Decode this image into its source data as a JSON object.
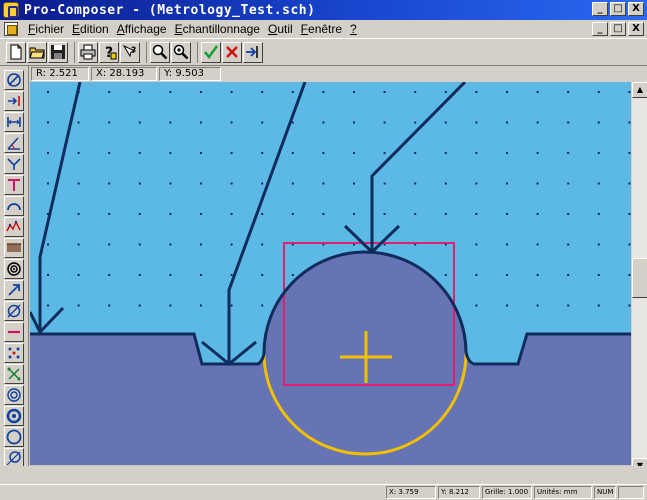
{
  "window": {
    "title": "Pro-Composer - (Metrology_Test.sch)",
    "controls": [
      "_",
      "□",
      "X"
    ]
  },
  "menu": {
    "items": [
      {
        "u": "F",
        "rest": "ichier"
      },
      {
        "u": "E",
        "rest": "dition"
      },
      {
        "u": "A",
        "rest": "ffichage"
      },
      {
        "u": "E",
        "rest": "chantillonnage"
      },
      {
        "u": "O",
        "rest": "util"
      },
      {
        "u": "F",
        "rest": "enêtre"
      },
      {
        "u": "?",
        "rest": ""
      }
    ],
    "doc_controls": [
      "_",
      "□",
      "X"
    ]
  },
  "toolbar": {
    "groups": [
      [
        "new-document-icon",
        "open-folder-icon",
        "save-disk-icon"
      ],
      [
        "print-icon",
        "help-question-icon",
        "context-help-icon"
      ],
      [
        "zoom-out-icon",
        "zoom-in-icon"
      ],
      [
        "checkmark-icon",
        "cross-icon",
        "exit-arrow-icon"
      ]
    ]
  },
  "coords": {
    "r_label": "R:",
    "r_value": "2.521",
    "x_label": "X:",
    "x_value": "28.193",
    "y_label": "Y:",
    "y_value": "9.503"
  },
  "palette": [
    "diameter-icon",
    "point-arrow-icon",
    "distance-icon",
    "angle-icon",
    "bisector-icon",
    "t-marker-icon",
    "arc-icon",
    "spline-icon",
    "comb-icon",
    "target-icon",
    "arrow-diagonal-icon",
    "diameter-alt-icon",
    "minus-icon",
    "dot-grid-icon",
    "cross-points-icon",
    "concentric-icon",
    "ring-icon",
    "circle-icon",
    "circle-tangent-icon",
    "base-line-icon"
  ],
  "canvas": {
    "background": "#5cb8e4",
    "part_fill": "#6673b4",
    "line_color": "#102c5c",
    "circle_color": "#f2c000",
    "rect_color": "#e0206e"
  },
  "status": {
    "x_label": "X:",
    "x_value": "3.759",
    "y_label": "Y:",
    "y_value": "8.212",
    "grid_label": "Grille:",
    "grid_value": "1.000",
    "units_label": "Unités:",
    "units_value": "mm",
    "num": "NUM"
  }
}
